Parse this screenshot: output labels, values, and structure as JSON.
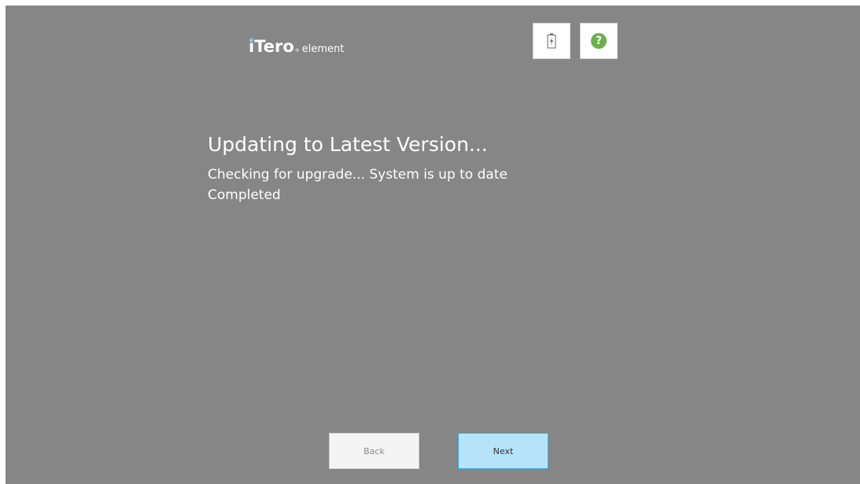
{
  "header": {
    "logo_brand": "iTero",
    "logo_reg": "®",
    "logo_sub": "element",
    "battery_icon": "battery-charging-icon",
    "help_icon": "help-icon",
    "help_symbol": "?"
  },
  "main": {
    "title": "Updating to Latest Version...",
    "status_line_1": "Checking for upgrade...  System is up to date",
    "status_line_2": "Completed"
  },
  "footer": {
    "back_label": "Back",
    "next_label": "Next"
  },
  "colors": {
    "background": "#868686",
    "next_button": "#b5e4fa",
    "next_border": "#3aa6d6",
    "help_green": "#6ab04c",
    "logo_dot": "#5ec8e6"
  }
}
